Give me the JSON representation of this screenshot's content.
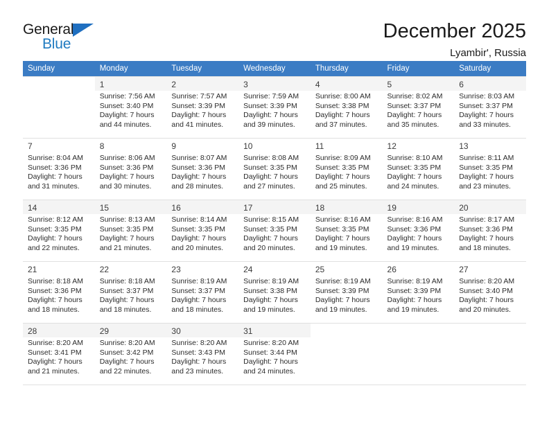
{
  "brand": {
    "line1": "General",
    "line2": "Blue",
    "triangle_color": "#1f6fc0",
    "blue_text_color": "#1f7ac0"
  },
  "header": {
    "month_title": "December 2025",
    "location": "Lyambir', Russia"
  },
  "theme": {
    "header_row_background": "#3b7cc4",
    "header_row_text": "#ffffff",
    "shaded_row_background": "#f4f4f4",
    "cell_border": "#e0e0e0"
  },
  "weekday_headers": [
    "Sunday",
    "Monday",
    "Tuesday",
    "Wednesday",
    "Thursday",
    "Friday",
    "Saturday"
  ],
  "labels": {
    "sunrise_prefix": "Sunrise:",
    "sunset_prefix": "Sunset:",
    "daylight_prefix": "Daylight:"
  },
  "weeks": [
    {
      "shaded": true,
      "days": [
        {
          "empty": true
        },
        {
          "day": "1",
          "sunrise": "Sunrise: 7:56 AM",
          "sunset": "Sunset: 3:40 PM",
          "daylight_line1": "Daylight: 7 hours",
          "daylight_line2": "and 44 minutes."
        },
        {
          "day": "2",
          "sunrise": "Sunrise: 7:57 AM",
          "sunset": "Sunset: 3:39 PM",
          "daylight_line1": "Daylight: 7 hours",
          "daylight_line2": "and 41 minutes."
        },
        {
          "day": "3",
          "sunrise": "Sunrise: 7:59 AM",
          "sunset": "Sunset: 3:39 PM",
          "daylight_line1": "Daylight: 7 hours",
          "daylight_line2": "and 39 minutes."
        },
        {
          "day": "4",
          "sunrise": "Sunrise: 8:00 AM",
          "sunset": "Sunset: 3:38 PM",
          "daylight_line1": "Daylight: 7 hours",
          "daylight_line2": "and 37 minutes."
        },
        {
          "day": "5",
          "sunrise": "Sunrise: 8:02 AM",
          "sunset": "Sunset: 3:37 PM",
          "daylight_line1": "Daylight: 7 hours",
          "daylight_line2": "and 35 minutes."
        },
        {
          "day": "6",
          "sunrise": "Sunrise: 8:03 AM",
          "sunset": "Sunset: 3:37 PM",
          "daylight_line1": "Daylight: 7 hours",
          "daylight_line2": "and 33 minutes."
        }
      ]
    },
    {
      "shaded": false,
      "days": [
        {
          "day": "7",
          "sunrise": "Sunrise: 8:04 AM",
          "sunset": "Sunset: 3:36 PM",
          "daylight_line1": "Daylight: 7 hours",
          "daylight_line2": "and 31 minutes."
        },
        {
          "day": "8",
          "sunrise": "Sunrise: 8:06 AM",
          "sunset": "Sunset: 3:36 PM",
          "daylight_line1": "Daylight: 7 hours",
          "daylight_line2": "and 30 minutes."
        },
        {
          "day": "9",
          "sunrise": "Sunrise: 8:07 AM",
          "sunset": "Sunset: 3:36 PM",
          "daylight_line1": "Daylight: 7 hours",
          "daylight_line2": "and 28 minutes."
        },
        {
          "day": "10",
          "sunrise": "Sunrise: 8:08 AM",
          "sunset": "Sunset: 3:35 PM",
          "daylight_line1": "Daylight: 7 hours",
          "daylight_line2": "and 27 minutes."
        },
        {
          "day": "11",
          "sunrise": "Sunrise: 8:09 AM",
          "sunset": "Sunset: 3:35 PM",
          "daylight_line1": "Daylight: 7 hours",
          "daylight_line2": "and 25 minutes."
        },
        {
          "day": "12",
          "sunrise": "Sunrise: 8:10 AM",
          "sunset": "Sunset: 3:35 PM",
          "daylight_line1": "Daylight: 7 hours",
          "daylight_line2": "and 24 minutes."
        },
        {
          "day": "13",
          "sunrise": "Sunrise: 8:11 AM",
          "sunset": "Sunset: 3:35 PM",
          "daylight_line1": "Daylight: 7 hours",
          "daylight_line2": "and 23 minutes."
        }
      ]
    },
    {
      "shaded": true,
      "days": [
        {
          "day": "14",
          "sunrise": "Sunrise: 8:12 AM",
          "sunset": "Sunset: 3:35 PM",
          "daylight_line1": "Daylight: 7 hours",
          "daylight_line2": "and 22 minutes."
        },
        {
          "day": "15",
          "sunrise": "Sunrise: 8:13 AM",
          "sunset": "Sunset: 3:35 PM",
          "daylight_line1": "Daylight: 7 hours",
          "daylight_line2": "and 21 minutes."
        },
        {
          "day": "16",
          "sunrise": "Sunrise: 8:14 AM",
          "sunset": "Sunset: 3:35 PM",
          "daylight_line1": "Daylight: 7 hours",
          "daylight_line2": "and 20 minutes."
        },
        {
          "day": "17",
          "sunrise": "Sunrise: 8:15 AM",
          "sunset": "Sunset: 3:35 PM",
          "daylight_line1": "Daylight: 7 hours",
          "daylight_line2": "and 20 minutes."
        },
        {
          "day": "18",
          "sunrise": "Sunrise: 8:16 AM",
          "sunset": "Sunset: 3:35 PM",
          "daylight_line1": "Daylight: 7 hours",
          "daylight_line2": "and 19 minutes."
        },
        {
          "day": "19",
          "sunrise": "Sunrise: 8:16 AM",
          "sunset": "Sunset: 3:36 PM",
          "daylight_line1": "Daylight: 7 hours",
          "daylight_line2": "and 19 minutes."
        },
        {
          "day": "20",
          "sunrise": "Sunrise: 8:17 AM",
          "sunset": "Sunset: 3:36 PM",
          "daylight_line1": "Daylight: 7 hours",
          "daylight_line2": "and 18 minutes."
        }
      ]
    },
    {
      "shaded": false,
      "days": [
        {
          "day": "21",
          "sunrise": "Sunrise: 8:18 AM",
          "sunset": "Sunset: 3:36 PM",
          "daylight_line1": "Daylight: 7 hours",
          "daylight_line2": "and 18 minutes."
        },
        {
          "day": "22",
          "sunrise": "Sunrise: 8:18 AM",
          "sunset": "Sunset: 3:37 PM",
          "daylight_line1": "Daylight: 7 hours",
          "daylight_line2": "and 18 minutes."
        },
        {
          "day": "23",
          "sunrise": "Sunrise: 8:19 AM",
          "sunset": "Sunset: 3:37 PM",
          "daylight_line1": "Daylight: 7 hours",
          "daylight_line2": "and 18 minutes."
        },
        {
          "day": "24",
          "sunrise": "Sunrise: 8:19 AM",
          "sunset": "Sunset: 3:38 PM",
          "daylight_line1": "Daylight: 7 hours",
          "daylight_line2": "and 19 minutes."
        },
        {
          "day": "25",
          "sunrise": "Sunrise: 8:19 AM",
          "sunset": "Sunset: 3:39 PM",
          "daylight_line1": "Daylight: 7 hours",
          "daylight_line2": "and 19 minutes."
        },
        {
          "day": "26",
          "sunrise": "Sunrise: 8:19 AM",
          "sunset": "Sunset: 3:39 PM",
          "daylight_line1": "Daylight: 7 hours",
          "daylight_line2": "and 19 minutes."
        },
        {
          "day": "27",
          "sunrise": "Sunrise: 8:20 AM",
          "sunset": "Sunset: 3:40 PM",
          "daylight_line1": "Daylight: 7 hours",
          "daylight_line2": "and 20 minutes."
        }
      ]
    },
    {
      "shaded": true,
      "days": [
        {
          "day": "28",
          "sunrise": "Sunrise: 8:20 AM",
          "sunset": "Sunset: 3:41 PM",
          "daylight_line1": "Daylight: 7 hours",
          "daylight_line2": "and 21 minutes."
        },
        {
          "day": "29",
          "sunrise": "Sunrise: 8:20 AM",
          "sunset": "Sunset: 3:42 PM",
          "daylight_line1": "Daylight: 7 hours",
          "daylight_line2": "and 22 minutes."
        },
        {
          "day": "30",
          "sunrise": "Sunrise: 8:20 AM",
          "sunset": "Sunset: 3:43 PM",
          "daylight_line1": "Daylight: 7 hours",
          "daylight_line2": "and 23 minutes."
        },
        {
          "day": "31",
          "sunrise": "Sunrise: 8:20 AM",
          "sunset": "Sunset: 3:44 PM",
          "daylight_line1": "Daylight: 7 hours",
          "daylight_line2": "and 24 minutes."
        },
        {
          "empty": true
        },
        {
          "empty": true
        },
        {
          "empty": true
        }
      ]
    }
  ]
}
